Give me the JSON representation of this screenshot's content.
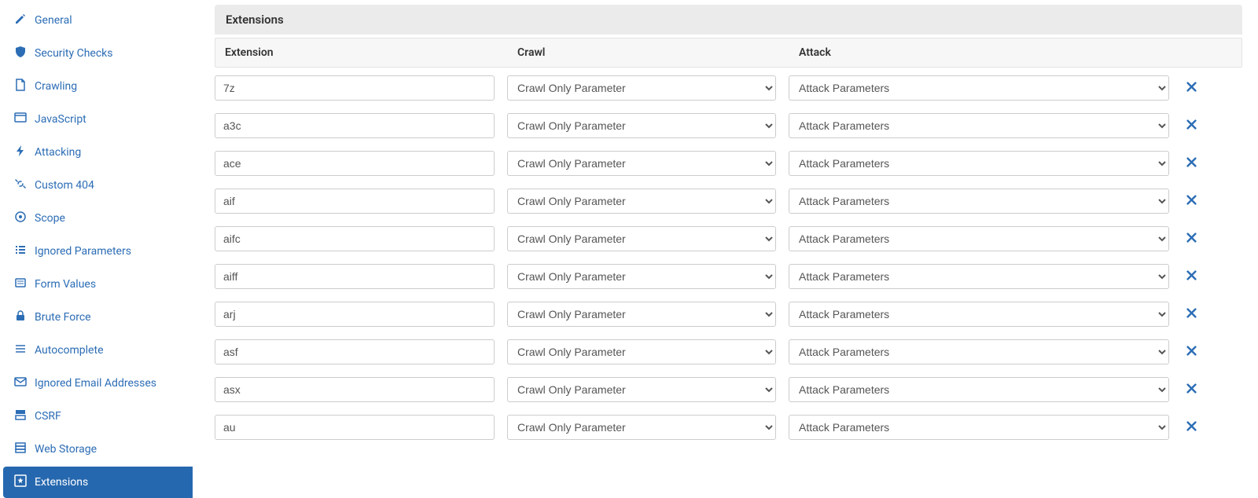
{
  "sidebar": {
    "items": [
      {
        "key": "general",
        "label": "General",
        "icon": "edit"
      },
      {
        "key": "security",
        "label": "Security Checks",
        "icon": "shield"
      },
      {
        "key": "crawling",
        "label": "Crawling",
        "icon": "file"
      },
      {
        "key": "javascript",
        "label": "JavaScript",
        "icon": "window"
      },
      {
        "key": "attacking",
        "label": "Attacking",
        "icon": "bolt"
      },
      {
        "key": "custom404",
        "label": "Custom 404",
        "icon": "link-broken"
      },
      {
        "key": "scope",
        "label": "Scope",
        "icon": "target"
      },
      {
        "key": "ignored-params",
        "label": "Ignored Parameters",
        "icon": "list"
      },
      {
        "key": "form-values",
        "label": "Form Values",
        "icon": "form"
      },
      {
        "key": "brute-force",
        "label": "Brute Force",
        "icon": "lock"
      },
      {
        "key": "autocomplete",
        "label": "Autocomplete",
        "icon": "lines"
      },
      {
        "key": "ignored-emails",
        "label": "Ignored Email Addresses",
        "icon": "mail"
      },
      {
        "key": "csrf",
        "label": "CSRF",
        "icon": "shield-alt"
      },
      {
        "key": "web-storage",
        "label": "Web Storage",
        "icon": "storage"
      },
      {
        "key": "extensions",
        "label": "Extensions",
        "icon": "star-box",
        "active": true
      }
    ]
  },
  "header": {
    "title": "Extensions"
  },
  "columns": {
    "extension": "Extension",
    "crawl": "Crawl",
    "attack": "Attack"
  },
  "crawl_options": [
    "Crawl Only Parameter"
  ],
  "attack_options": [
    "Attack Parameters"
  ],
  "rows": [
    {
      "ext": "7z",
      "crawl": "Crawl Only Parameter",
      "attack": "Attack Parameters"
    },
    {
      "ext": "a3c",
      "crawl": "Crawl Only Parameter",
      "attack": "Attack Parameters"
    },
    {
      "ext": "ace",
      "crawl": "Crawl Only Parameter",
      "attack": "Attack Parameters"
    },
    {
      "ext": "aif",
      "crawl": "Crawl Only Parameter",
      "attack": "Attack Parameters"
    },
    {
      "ext": "aifc",
      "crawl": "Crawl Only Parameter",
      "attack": "Attack Parameters"
    },
    {
      "ext": "aiff",
      "crawl": "Crawl Only Parameter",
      "attack": "Attack Parameters"
    },
    {
      "ext": "arj",
      "crawl": "Crawl Only Parameter",
      "attack": "Attack Parameters"
    },
    {
      "ext": "asf",
      "crawl": "Crawl Only Parameter",
      "attack": "Attack Parameters"
    },
    {
      "ext": "asx",
      "crawl": "Crawl Only Parameter",
      "attack": "Attack Parameters"
    },
    {
      "ext": "au",
      "crawl": "Crawl Only Parameter",
      "attack": "Attack Parameters"
    }
  ]
}
